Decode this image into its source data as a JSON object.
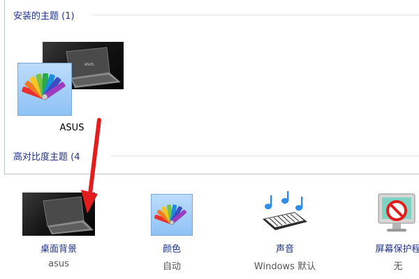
{
  "themes": {
    "installed_header": "安装的主题 (1)",
    "installed": [
      {
        "name": "ASUS"
      }
    ],
    "high_contrast_header": "高对比度主题 (4"
  },
  "bottom_bar": {
    "items": [
      {
        "label": "桌面背景",
        "value": "asus"
      },
      {
        "label": "颜色",
        "value": "自动"
      },
      {
        "label": "声音",
        "value": "Windows 默认"
      },
      {
        "label": "屏幕保护程",
        "value": "无"
      }
    ]
  },
  "colors": {
    "link_blue": "#1e3287",
    "annotation_red": "#e11d1d"
  },
  "icons": [
    "laptop-wallpaper-icon",
    "color-fan-icon",
    "sound-keyboard-icon",
    "screensaver-none-icon"
  ]
}
